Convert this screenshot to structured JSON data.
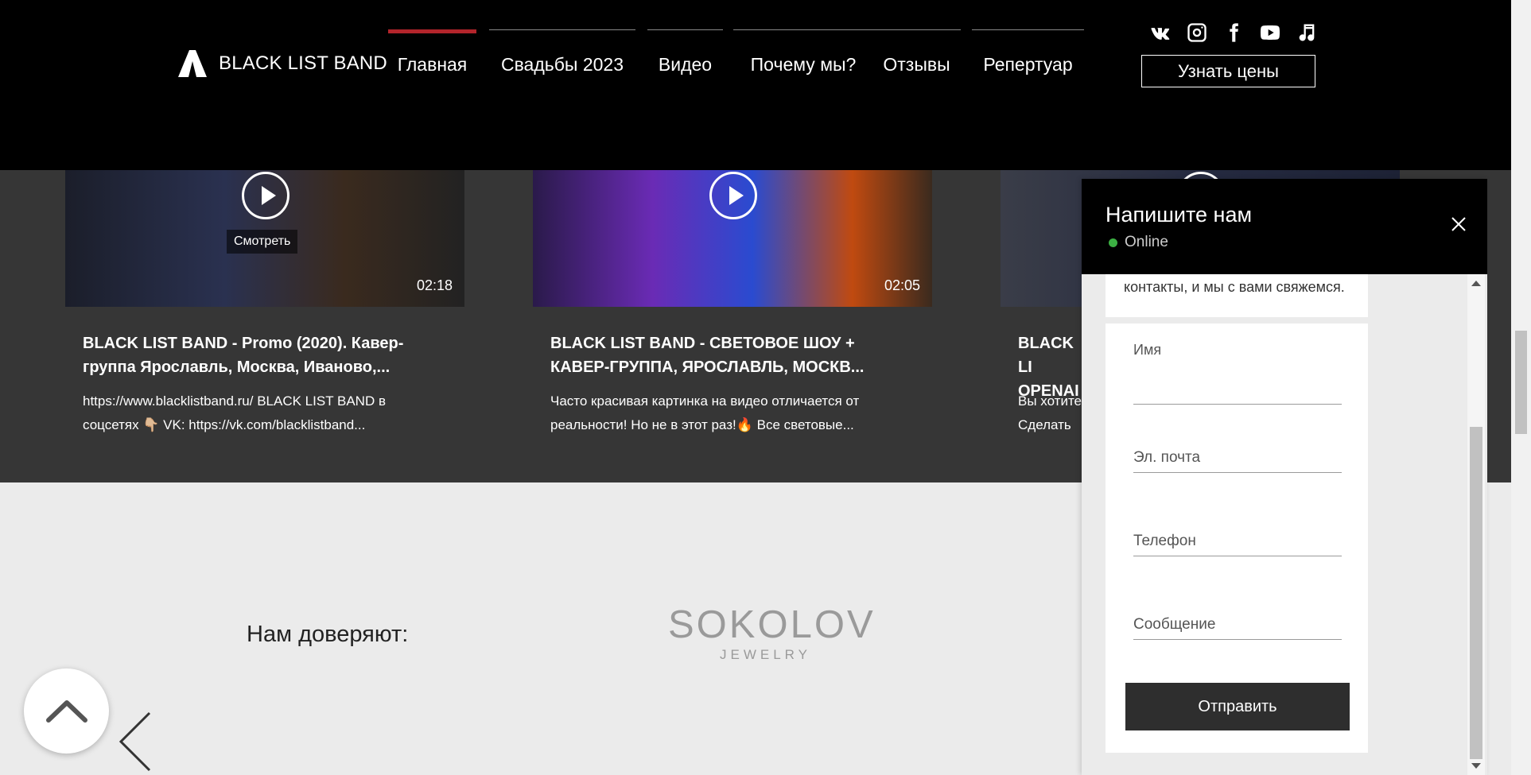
{
  "header": {
    "logo_text": "BLACK LIST BAND",
    "nav": [
      {
        "label": "Главная",
        "active": true
      },
      {
        "label": "Свадьбы 2023",
        "active": false
      },
      {
        "label": "Видео",
        "active": false
      },
      {
        "label": "Почему мы?",
        "active": false
      },
      {
        "label": "Отзывы",
        "active": false
      },
      {
        "label": "Репертуар",
        "active": false
      }
    ],
    "social_icons": [
      "vk-icon",
      "instagram-icon",
      "facebook-icon",
      "youtube-icon",
      "music-icon"
    ],
    "price_button": "Узнать цены"
  },
  "videos": [
    {
      "watch_label": "Смотреть",
      "duration": "02:18",
      "title": "BLACK LIST BAND - Promo (2020). Кавер-группа Ярославль, Москва, Иваново,...",
      "description": "https://www.blacklistband.ru/ BLACK LIST BAND в соцсетях 👇🏼 VK: https://vk.com/blacklistband..."
    },
    {
      "duration": "02:05",
      "title": "BLACK LIST BAND - СВЕТОВОЕ ШОУ + КАВЕР-ГРУППА, ЯРОСЛАВЛЬ, МОСКВ...",
      "description": "Часто красивая картинка на видео отличается от реальности! Но не в этот раз!🔥 Все световые..."
    },
    {
      "title": "BLACK LI OPENAI",
      "description": "Вы хотите Сделать"
    }
  ],
  "trust": {
    "title": "Нам доверяют:",
    "partner_main": "SOKOLOV",
    "partner_sub": "JEWELRY"
  },
  "chat": {
    "title": "Напишите нам",
    "status": "Online",
    "message": "контакты, и мы с вами свяжемся.",
    "fields": {
      "name": "Имя",
      "email": "Эл. почта",
      "phone": "Телефон",
      "message": "Сообщение"
    },
    "send_label": "Отправить"
  },
  "colors": {
    "accent": "#b3242b",
    "header_bg": "#000000",
    "video_section_bg": "#363636",
    "online": "#3cb043"
  }
}
